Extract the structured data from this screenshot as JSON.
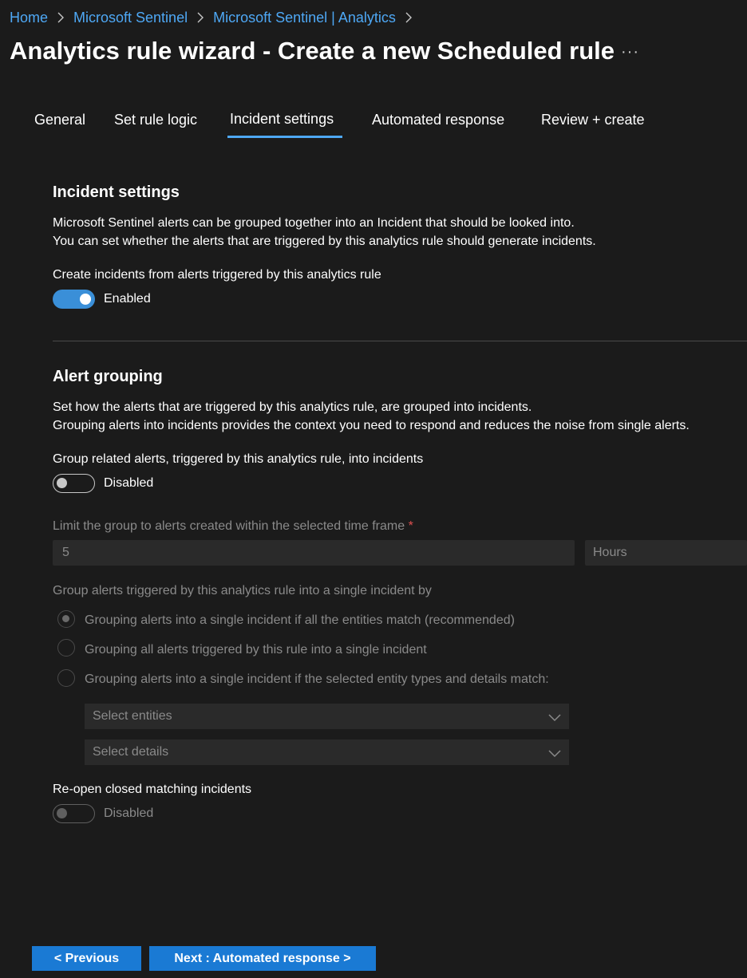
{
  "breadcrumb": {
    "items": [
      "Home",
      "Microsoft Sentinel",
      "Microsoft Sentinel | Analytics"
    ]
  },
  "page": {
    "title": "Analytics rule wizard - Create a new Scheduled rule",
    "more_label": "···"
  },
  "tabs": [
    {
      "label": "General"
    },
    {
      "label": "Set rule logic"
    },
    {
      "label": "Incident settings",
      "selected": true
    },
    {
      "label": "Automated response"
    },
    {
      "label": "Review + create"
    }
  ],
  "incident_settings": {
    "heading": "Incident settings",
    "desc_line1": "Microsoft Sentinel alerts can be grouped together into an Incident that should be looked into.",
    "desc_line2": "You can set whether the alerts that are triggered by this analytics rule should generate incidents.",
    "create_label": "Create incidents from alerts triggered by this analytics rule",
    "create_toggle_text": "Enabled"
  },
  "alert_grouping": {
    "heading": "Alert grouping",
    "desc_line1": "Set how the alerts that are triggered by this analytics rule, are grouped into incidents.",
    "desc_line2": "Grouping alerts into incidents provides the context you need to respond and reduces the noise from single alerts.",
    "group_label": "Group related alerts, triggered by this analytics rule, into incidents",
    "group_toggle_text": "Disabled",
    "limit_label": "Limit the group to alerts created within the selected time frame",
    "required_mark": "*",
    "limit_value": "5",
    "limit_unit": "Hours",
    "by_label": "Group alerts triggered by this analytics rule into a single incident by",
    "options": [
      {
        "label": "Grouping alerts into a single incident if all the entities match (recommended)",
        "checked": true
      },
      {
        "label": "Grouping all alerts triggered by this rule into a single incident"
      },
      {
        "label": "Grouping alerts into a single incident if the selected entity types and details match:"
      }
    ],
    "entities_placeholder": "Select entities",
    "details_placeholder": "Select details",
    "reopen_label": "Re-open closed matching incidents",
    "reopen_toggle_text": "Disabled"
  },
  "footer": {
    "previous": "< Previous",
    "next": "Next : Automated response >"
  },
  "colors": {
    "background": "#1b1b1b",
    "accent": "#4ea8f5",
    "button": "#1a7ad4",
    "required": "#e05050"
  }
}
